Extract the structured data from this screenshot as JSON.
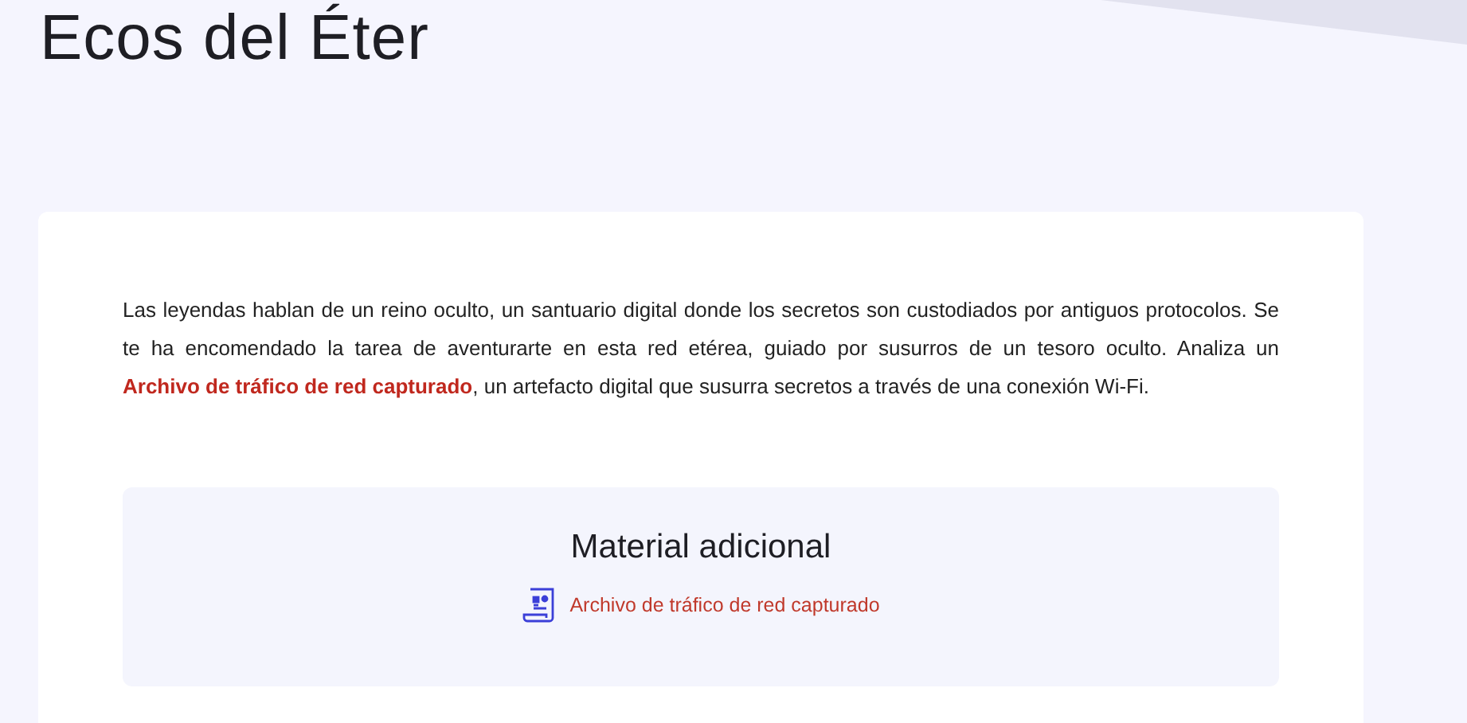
{
  "title": "Ecos del Éter",
  "intro": {
    "text_before": "Las leyendas hablan de un reino oculto, un santuario digital donde los secretos son custodiados por antiguos protocolos. Se te ha encomendado la tarea de aventurarte en esta red etérea, guiado por susurros de un tesoro oculto. Analiza un ",
    "link": "Archivo de tráfico de red capturado",
    "text_after": ", un artefacto digital que susurra secretos a través de una conexión Wi-Fi."
  },
  "additional_material": {
    "heading": "Material adicional",
    "files": [
      {
        "label": "Archivo de tráfico de red capturado"
      }
    ]
  }
}
